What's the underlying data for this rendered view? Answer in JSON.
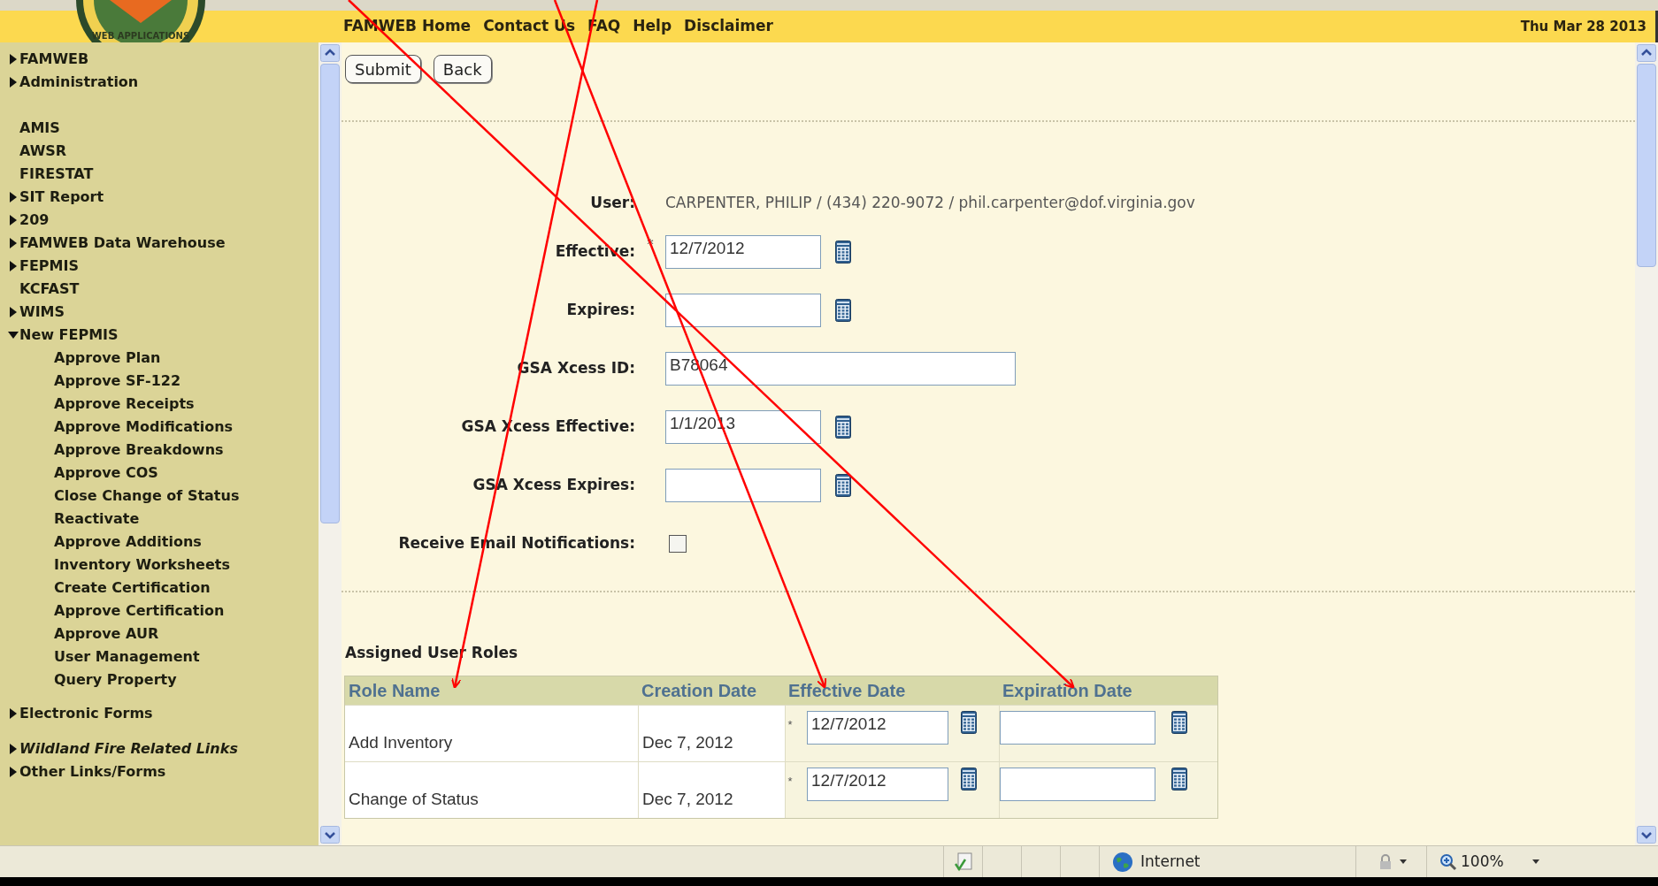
{
  "logo_text": "WEB APPLICATIONS",
  "required_mark": "*",
  "header": {
    "nav": [
      "FAMWEB Home",
      "Contact Us",
      "FAQ",
      "Help",
      "Disclaimer"
    ],
    "date": "Thu Mar 28 2013"
  },
  "sidebar": {
    "groups": [
      [
        {
          "label": "FAMWEB",
          "kind": "folder",
          "expanded": false,
          "italic": false
        },
        {
          "label": "Administration",
          "kind": "folder",
          "expanded": false,
          "italic": false
        }
      ],
      [
        {
          "label": "AMIS",
          "kind": "link",
          "italic": false
        },
        {
          "label": "AWSR",
          "kind": "link",
          "italic": false
        },
        {
          "label": "FIRESTAT",
          "kind": "link",
          "italic": false
        },
        {
          "label": "SIT Report",
          "kind": "folder",
          "expanded": false,
          "italic": false
        },
        {
          "label": "209",
          "kind": "folder",
          "expanded": false,
          "italic": false
        },
        {
          "label": "FAMWEB Data Warehouse",
          "kind": "folder",
          "expanded": false,
          "italic": false
        },
        {
          "label": "FEPMIS",
          "kind": "folder",
          "expanded": false,
          "italic": false
        },
        {
          "label": "KCFAST",
          "kind": "link",
          "italic": false
        },
        {
          "label": "WIMS",
          "kind": "folder",
          "expanded": false,
          "italic": false
        },
        {
          "label": "New FEPMIS",
          "kind": "folder",
          "expanded": true,
          "italic": false,
          "children": [
            {
              "label": "Approve Plan"
            },
            {
              "label": "Approve SF-122"
            },
            {
              "label": "Approve Receipts"
            },
            {
              "label": "Approve Modifications"
            },
            {
              "label": "Approve Breakdowns"
            },
            {
              "label": "Approve COS"
            },
            {
              "label": "Close Change of Status"
            },
            {
              "label": "Reactivate"
            },
            {
              "label": "Approve Additions"
            },
            {
              "label": "Inventory Worksheets"
            },
            {
              "label": "Create Certification"
            },
            {
              "label": "Approve Certification"
            },
            {
              "label": "Approve AUR"
            },
            {
              "label": "User Management"
            },
            {
              "label": "Query Property"
            }
          ]
        }
      ],
      [
        {
          "label": "Electronic Forms",
          "kind": "folder",
          "expanded": false,
          "italic": false
        }
      ],
      [
        {
          "label": "Wildland Fire Related Links",
          "kind": "folder",
          "expanded": false,
          "italic": true
        },
        {
          "label": "Other Links/Forms",
          "kind": "folder",
          "expanded": false,
          "italic": false
        }
      ]
    ]
  },
  "buttons": [
    "Submit",
    "Back"
  ],
  "form": [
    {
      "label": "User:",
      "kind": "static",
      "value": "CARPENTER, PHILIP / (434) 220-9072 / phil.carpenter@dof.virginia.gov"
    },
    {
      "label": "Effective:",
      "kind": "date",
      "required": true,
      "value": "12/7/2012"
    },
    {
      "label": "Expires:",
      "kind": "date",
      "required": false
    },
    {
      "label": "GSA Xcess ID:",
      "kind": "text",
      "required": false,
      "value": "B78064"
    },
    {
      "label": "GSA Xcess Effective:",
      "kind": "date",
      "required": false,
      "value": "1/1/2013"
    },
    {
      "label": "GSA Xcess Expires:",
      "kind": "date",
      "required": false
    },
    {
      "label": "Receive Email Notifications:",
      "kind": "checkbox",
      "checked": false
    }
  ],
  "roles": {
    "title": "Assigned User Roles",
    "columns": [
      "Role Name",
      "Creation Date",
      "Effective Date",
      "Expiration Date"
    ],
    "rows": [
      {
        "role_name": "Add Inventory",
        "creation_date": "Dec 7, 2012",
        "effective": {
          "value": "12/7/2012",
          "required": true
        },
        "expiration": {}
      },
      {
        "role_name": "Change of Status",
        "creation_date": "Dec 7, 2012",
        "effective": {
          "value": "12/7/2012",
          "required": true
        },
        "expiration": {}
      }
    ]
  },
  "status_bar": {
    "zone": "Internet",
    "zoom": "100%"
  }
}
